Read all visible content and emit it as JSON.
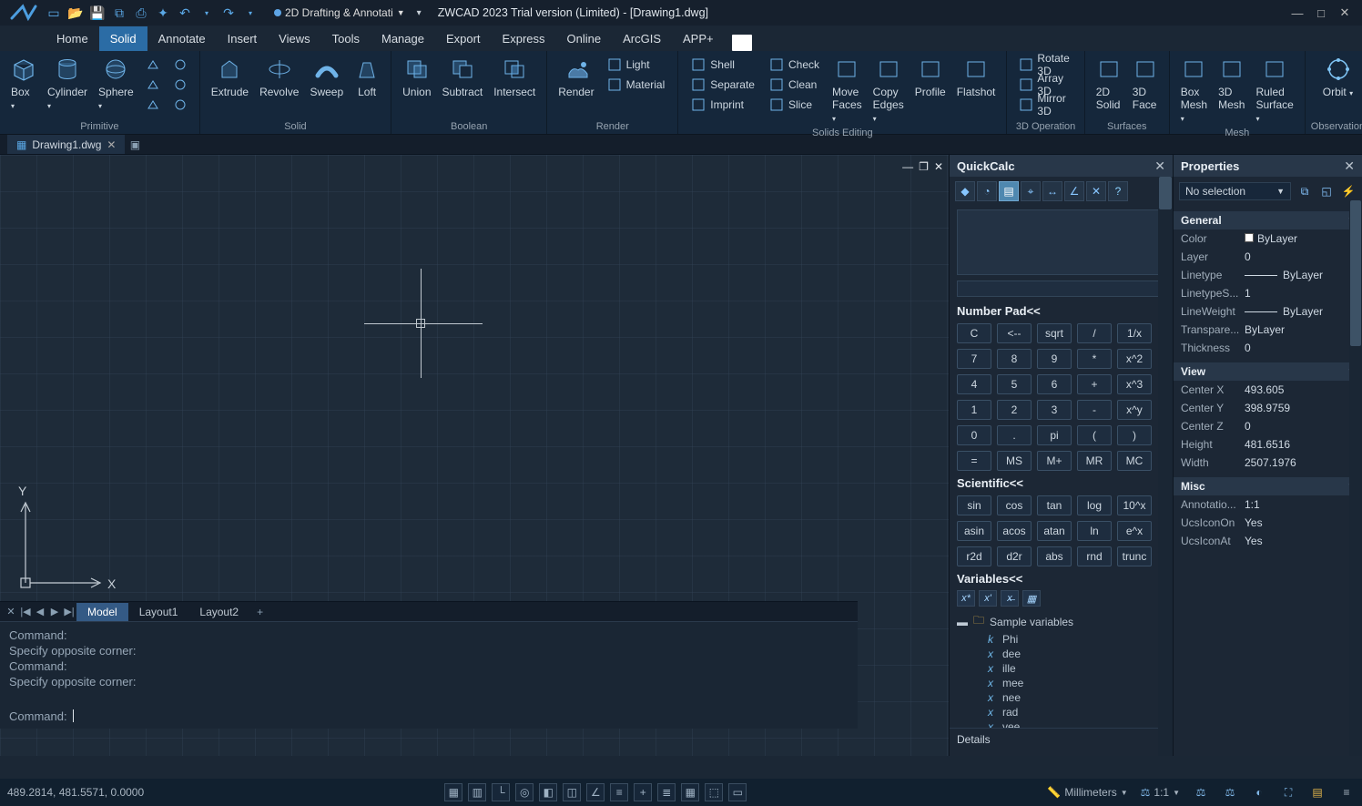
{
  "title": "ZWCAD 2023 Trial version (Limited) - [Drawing1.dwg]",
  "workspace": "2D Drafting & Annotati",
  "menu": [
    "Home",
    "Solid",
    "Annotate",
    "Insert",
    "Views",
    "Tools",
    "Manage",
    "Export",
    "Express",
    "Online",
    "ArcGIS",
    "APP+"
  ],
  "menu_active": 1,
  "ribbon": {
    "groups": [
      {
        "title": "Primitive",
        "big": [
          "Box",
          "Cylinder",
          "Sphere"
        ]
      },
      {
        "title": "Solid",
        "big": [
          "Extrude",
          "Revolve",
          "Sweep",
          "Loft"
        ]
      },
      {
        "title": "Boolean",
        "big": [
          "Union",
          "Subtract",
          "Intersect"
        ]
      },
      {
        "title": "Render",
        "big": [
          "Render"
        ],
        "small": [
          "Light",
          "Material"
        ]
      },
      {
        "title": "Solids Editing",
        "col1": [
          "Shell",
          "Separate",
          "Imprint"
        ],
        "col2": [
          "Check",
          "Clean",
          "Slice"
        ],
        "big": [
          "Move Faces",
          "Copy Edges",
          "Profile",
          "Flatshot"
        ]
      },
      {
        "title": "3D Operation",
        "small": [
          "Rotate 3D",
          "Array 3D",
          "Mirror 3D"
        ]
      },
      {
        "title": "Surfaces",
        "big": [
          "2D Solid",
          "3D Face"
        ]
      },
      {
        "title": "Mesh",
        "big": [
          "Box Mesh",
          "3D Mesh",
          "Ruled Surface"
        ]
      },
      {
        "title": "Observation",
        "big": [
          "Orbit"
        ]
      }
    ]
  },
  "doc_tab": "Drawing1.dwg",
  "layout_tabs": [
    "Model",
    "Layout1",
    "Layout2"
  ],
  "layout_active": 0,
  "command_lines": [
    "Command:",
    "Specify opposite corner:",
    "Command:",
    "Specify opposite corner:"
  ],
  "command_prompt": "Command:",
  "status_coords": "489.2814, 481.5571, 0.0000",
  "status_right": {
    "units": "Millimeters",
    "scale": "1:1"
  },
  "quickcalc": {
    "title": "QuickCalc",
    "numpad_title": "Number Pad<<",
    "numpad": [
      [
        "C",
        "<--",
        "sqrt",
        "/",
        "1/x"
      ],
      [
        "7",
        "8",
        "9",
        "*",
        "x^2"
      ],
      [
        "4",
        "5",
        "6",
        "+",
        "x^3"
      ],
      [
        "1",
        "2",
        "3",
        "-",
        "x^y"
      ],
      [
        "0",
        ".",
        "pi",
        "(",
        ")"
      ],
      [
        "=",
        "MS",
        "M+",
        "MR",
        "MC"
      ]
    ],
    "sci_title": "Scientific<<",
    "sci": [
      [
        "sin",
        "cos",
        "tan",
        "log",
        "10^x"
      ],
      [
        "asin",
        "acos",
        "atan",
        "ln",
        "e^x"
      ],
      [
        "r2d",
        "d2r",
        "abs",
        "rnd",
        "trunc"
      ]
    ],
    "var_title": "Variables<<",
    "var_root": "Sample variables",
    "vars": [
      "Phi",
      "dee",
      "ille",
      "mee",
      "nee",
      "rad",
      "vee"
    ],
    "details": "Details"
  },
  "properties": {
    "title": "Properties",
    "selection": "No selection",
    "groups": [
      {
        "name": "General",
        "rows": [
          [
            "Color",
            "ByLayer",
            true
          ],
          [
            "Layer",
            "0"
          ],
          [
            "Linetype",
            "ByLayer"
          ],
          [
            "LinetypeS...",
            "1"
          ],
          [
            "LineWeight",
            "ByLayer"
          ],
          [
            "Transpare...",
            "ByLayer"
          ],
          [
            "Thickness",
            "0"
          ]
        ]
      },
      {
        "name": "View",
        "rows": [
          [
            "Center X",
            "493.605"
          ],
          [
            "Center Y",
            "398.9759"
          ],
          [
            "Center Z",
            "0"
          ],
          [
            "Height",
            "481.6516"
          ],
          [
            "Width",
            "2507.1976"
          ]
        ]
      },
      {
        "name": "Misc",
        "rows": [
          [
            "Annotatio...",
            "1:1"
          ],
          [
            "UcsIconOn",
            "Yes"
          ],
          [
            "UcsIconAt",
            "Yes"
          ]
        ]
      }
    ]
  }
}
